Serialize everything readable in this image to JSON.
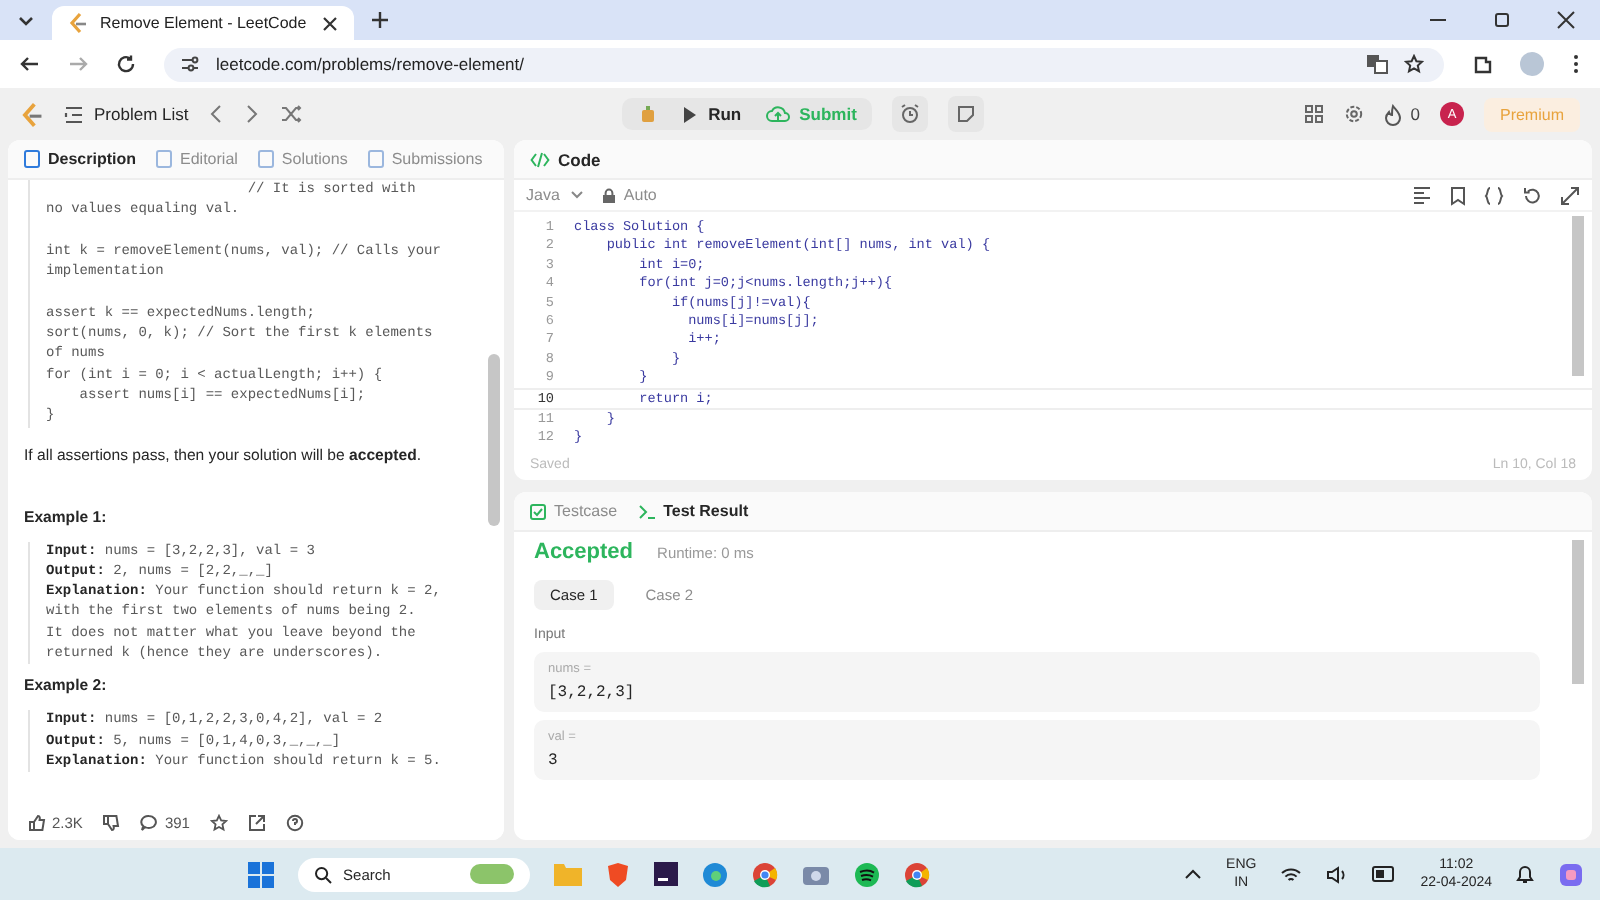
{
  "browser": {
    "tabs": [
      {
        "title": "Remove Element - LeetCode",
        "selected": true
      }
    ],
    "url": "leetcode.com/problems/remove-element/"
  },
  "toolbar": {
    "problem_list": "Problem List",
    "run": "Run",
    "submit": "Submit",
    "streak": "0",
    "avatar": "A",
    "premium": "Premium"
  },
  "description": {
    "tabs": [
      {
        "label": "Description",
        "selected": true
      },
      {
        "label": "Editorial",
        "selected": false
      },
      {
        "label": "Solutions",
        "selected": false
      },
      {
        "label": "Submissions",
        "selected": false
      }
    ],
    "code_groups": [
      [
        "                        // It is sorted with",
        "no values equaling val."
      ],
      [
        "int k = removeElement(nums, val); // Calls your",
        "implementation"
      ],
      [
        "assert k == expectedNums.length;",
        "sort(nums, 0, k); // Sort the first k elements",
        "of nums",
        "for (int i = 0; i < actualLength; i++) {",
        "    assert nums[i] == expectedNums[i];",
        "}"
      ]
    ],
    "paragraph": "If all assertions pass, then your solution will be **accepted**.",
    "examples": [
      {
        "title": "Example 1:",
        "lines": [
          "**Input:** nums = [3,2,2,3], val = 3",
          "**Output:** 2, nums = [2,2,_,_]",
          "**Explanation:** Your function should return k = 2,",
          "with the first two elements of nums being 2.",
          "It does not matter what you leave beyond the",
          "returned k (hence they are underscores)."
        ]
      },
      {
        "title": "Example 2:",
        "lines": [
          "**Input:** nums = [0,1,2,2,3,0,4,2], val = 2",
          "**Output:** 5, nums = [0,1,4,0,3,_,_,_]",
          "**Explanation:** Your function should return k = 5."
        ]
      }
    ],
    "likes": "2.3K",
    "comments": "391"
  },
  "editor": {
    "title": "Code",
    "language": "Java",
    "mode": "Auto",
    "lines": [
      {
        "number": "1",
        "text": "class Solution {",
        "current": false
      },
      {
        "number": "2",
        "text": "    public int removeElement(int[] nums, int val) {",
        "current": false
      },
      {
        "number": "3",
        "text": "        int i=0;",
        "current": false
      },
      {
        "number": "4",
        "text": "        for(int j=0;j<nums.length;j++){",
        "current": false
      },
      {
        "number": "5",
        "text": "            if(nums[j]!=val){",
        "current": false
      },
      {
        "number": "6",
        "text": "              nums[i]=nums[j];",
        "current": false
      },
      {
        "number": "7",
        "text": "              i++;",
        "current": false
      },
      {
        "number": "8",
        "text": "            }",
        "current": false
      },
      {
        "number": "9",
        "text": "        }",
        "current": false
      },
      {
        "number": "10",
        "text": "        return i;",
        "current": true
      },
      {
        "number": "11",
        "text": "    }",
        "current": false
      },
      {
        "number": "12",
        "text": "}",
        "current": false
      }
    ],
    "status": "Saved",
    "position": "Ln 10, Col 18"
  },
  "result": {
    "tabs": [
      {
        "label": "Testcase",
        "selected": false
      },
      {
        "label": "Test Result",
        "selected": true
      }
    ],
    "verdict": "Accepted",
    "runtime": "Runtime: 0 ms",
    "cases": [
      {
        "label": "Case 1",
        "selected": true
      },
      {
        "label": "Case 2",
        "selected": false
      }
    ],
    "input_label": "Input",
    "params": [
      {
        "name": "nums =",
        "value": "[3,2,2,3]"
      },
      {
        "name": "val =",
        "value": "3"
      }
    ]
  },
  "taskbar": {
    "search": "Search",
    "language": "ENG",
    "region": "IN",
    "time": "11:02",
    "date": "22-04-2024"
  }
}
